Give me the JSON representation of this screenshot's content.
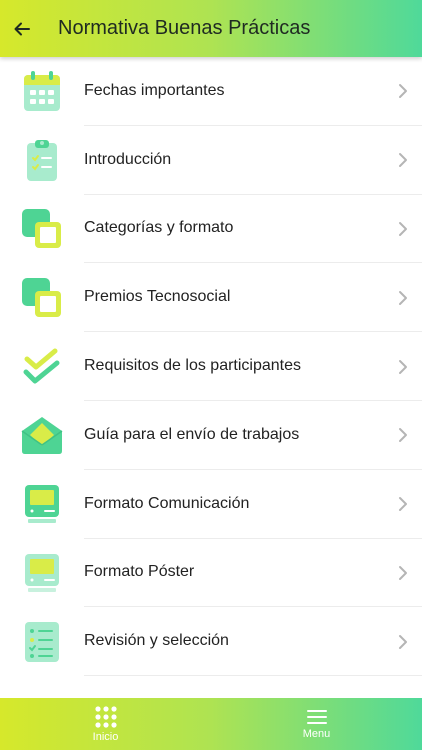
{
  "header": {
    "back_icon": "arrow-left-icon",
    "title": "Normativa Buenas Prácticas"
  },
  "menu": {
    "items": [
      {
        "label": "Fechas importantes",
        "icon": "calendar-icon"
      },
      {
        "label": "Introducción",
        "icon": "clipboard-icon"
      },
      {
        "label": "Categorías y formato",
        "icon": "layered-squares-icon"
      },
      {
        "label": "Premios Tecnosocial",
        "icon": "layered-squares-icon"
      },
      {
        "label": "Requisitos de los participantes",
        "icon": "double-check-icon"
      },
      {
        "label": "Guía para el envío de trabajos",
        "icon": "open-envelope-icon"
      },
      {
        "label": "Formato Comunicación",
        "icon": "monitor-icon"
      },
      {
        "label": "Formato Póster",
        "icon": "poster-monitor-icon"
      },
      {
        "label": "Revisión y selección",
        "icon": "checklist-icon"
      }
    ]
  },
  "tabbar": {
    "home_label": "Inicio",
    "home_icon": "grid-dots-icon",
    "menu_label": "Menu",
    "menu_icon": "hamburger-icon"
  },
  "colors": {
    "gradient_start": "#d6e82b",
    "gradient_end": "#4fd99a",
    "icon_green": "#4ed494",
    "icon_yellow": "#d9ec48",
    "icon_pale": "#a8ebcd"
  }
}
